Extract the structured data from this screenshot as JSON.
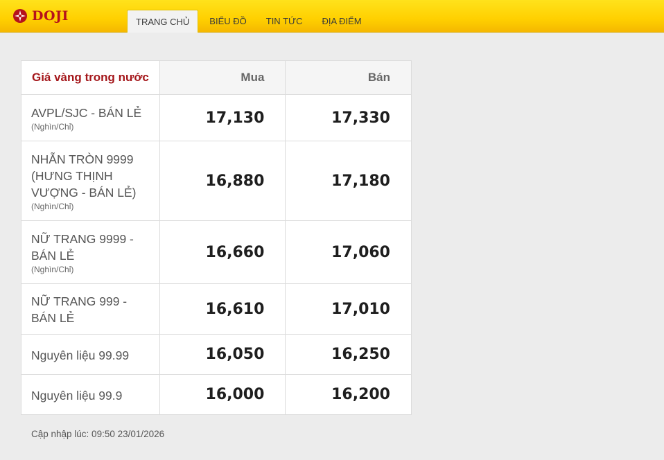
{
  "brand": {
    "name": "DOJI"
  },
  "nav": {
    "items": [
      {
        "label": "TRANG CHỦ",
        "active": true
      },
      {
        "label": "BIỂU ĐỒ"
      },
      {
        "label": "TIN TỨC"
      },
      {
        "label": "ĐỊA ĐIỂM"
      }
    ]
  },
  "table": {
    "title": "Giá vàng trong nước",
    "columns": {
      "buy": "Mua",
      "sell": "Bán"
    },
    "rows": [
      {
        "name": "AVPL/SJC - BÁN LẺ",
        "unit": "(Nghìn/Chỉ)",
        "buy": "17,130",
        "sell": "17,330"
      },
      {
        "name": "NHẪN TRÒN 9999 (HƯNG THỊNH VƯỢNG - BÁN LẺ)",
        "unit": "(Nghìn/Chỉ)",
        "buy": "16,880",
        "sell": "17,180"
      },
      {
        "name": "NỮ TRANG 9999 - BÁN LẺ",
        "unit": "(Nghìn/Chỉ)",
        "buy": "16,660",
        "sell": "17,060"
      },
      {
        "name": "NỮ TRANG 999 - BÁN LẺ",
        "unit": "",
        "buy": "16,610",
        "sell": "17,010"
      },
      {
        "name": "Nguyên liệu 99.99",
        "unit": "",
        "buy": "16,050",
        "sell": "16,250"
      },
      {
        "name": "Nguyên liệu 99.9",
        "unit": "",
        "buy": "16,000",
        "sell": "16,200"
      }
    ]
  },
  "updated": "Cập nhập lúc: 09:50 23/01/2026",
  "colors": {
    "header_yellow": "#ffd000",
    "brand_red": "#b5121b"
  }
}
